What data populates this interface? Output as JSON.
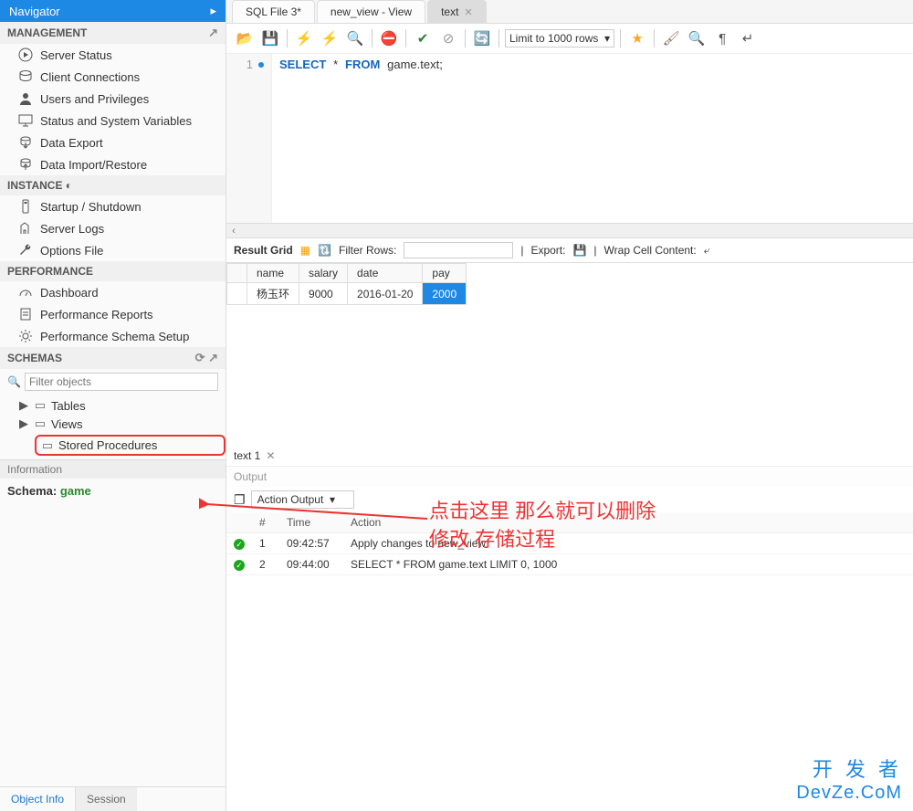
{
  "sidebar": {
    "title": "Navigator",
    "management": {
      "header": "MANAGEMENT",
      "items": [
        "Server Status",
        "Client Connections",
        "Users and Privileges",
        "Status and System Variables",
        "Data Export",
        "Data Import/Restore"
      ]
    },
    "instance": {
      "header": "INSTANCE",
      "items": [
        "Startup / Shutdown",
        "Server Logs",
        "Options File"
      ]
    },
    "performance": {
      "header": "PERFORMANCE",
      "items": [
        "Dashboard",
        "Performance Reports",
        "Performance Schema Setup"
      ]
    },
    "schemas": {
      "header": "SCHEMAS",
      "filter_placeholder": "Filter objects",
      "tree": {
        "tables": "Tables",
        "views": "Views",
        "stored_procedures": "Stored Procedures"
      }
    },
    "info": {
      "header": "Information",
      "label": "Schema:",
      "value": "game"
    },
    "bottom_tabs": {
      "object_info": "Object Info",
      "session": "Session"
    }
  },
  "main": {
    "tabs": [
      {
        "label": "SQL File 3*",
        "active": false
      },
      {
        "label": "new_view - View",
        "active": false
      },
      {
        "label": "text",
        "active": true
      }
    ],
    "toolbar": {
      "limit_label": "Limit to 1000 rows"
    },
    "editor": {
      "line_no": "1",
      "code_kw_select": "SELECT",
      "code_star": "*",
      "code_kw_from": "FROM",
      "code_ident": "game.text",
      "code_semi": ";"
    },
    "result_toolbar": {
      "result_grid": "Result Grid",
      "filter_rows": "Filter Rows:",
      "export": "Export:",
      "wrap": "Wrap Cell Content:"
    },
    "grid": {
      "headers": [
        "",
        "name",
        "salary",
        "date",
        "pay"
      ],
      "row": {
        "name": "杨玉环",
        "salary": "9000",
        "date": "2016-01-20",
        "pay": "2000"
      }
    },
    "inner_tab": {
      "label": "text 1"
    },
    "output": {
      "title": "Output",
      "selector": "Action Output",
      "headers": [
        "",
        "#",
        "Time",
        "Action"
      ],
      "rows": [
        {
          "num": "1",
          "time": "09:42:57",
          "action": "Apply changes to new_view"
        },
        {
          "num": "2",
          "time": "09:44:00",
          "action": "SELECT * FROM game.text LIMIT 0, 1000"
        }
      ]
    }
  },
  "annotation": {
    "line1": "点击这里 那么就可以删除",
    "line2": "修改 存储过程"
  },
  "watermark": {
    "l1": "开 发 者",
    "l2": "DevZe.CoM"
  }
}
